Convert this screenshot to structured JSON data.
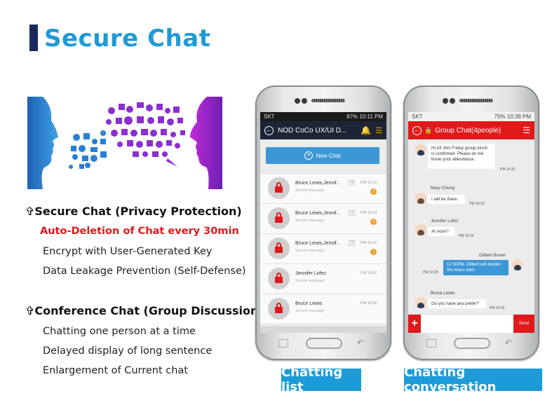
{
  "slide": {
    "title": "Secure Chat",
    "accent_color": "#1f9ad6",
    "bar_color": "#1b2a5c"
  },
  "features": {
    "secure": {
      "icon": "cross-bullet-icon",
      "heading": "✞Secure Chat (Privacy Protection)",
      "items": [
        "Auto-Deletion of Chat every 30min",
        "Encrypt with User-Generated Key",
        "Data Leakage Prevention (Self-Defense)"
      ]
    },
    "conference": {
      "icon": "cross-bullet-icon",
      "heading": "✞Conference Chat (Group Discussion)",
      "items": [
        "Chatting one person at a time",
        "Delayed display of long sentence",
        "Enlargement of Current chat"
      ]
    }
  },
  "list_phone": {
    "status": {
      "carrier": "SKT",
      "battery": "87%",
      "time": "10:11 PM"
    },
    "header_title": "NOD CoCo UX/UI D...",
    "new_chat_label": "New Chat",
    "rows": [
      {
        "name": "Bruce Lewis,Jennif...",
        "sub": "Secure message",
        "count": "4",
        "time": "PM 10:10",
        "badge": "2"
      },
      {
        "name": "Bruce Lewis,Jennif...",
        "sub": "Secure message",
        "count": "3",
        "time": "PM 10:10",
        "badge": "3"
      },
      {
        "name": "Bruce Lewis,Jennif...",
        "sub": "Secure message",
        "count": "3",
        "time": "PM 10:10",
        "badge": "2"
      },
      {
        "name": "Jennifer Lofez",
        "sub": "Secure message",
        "count": "",
        "time": "PM 10:07",
        "badge": ""
      },
      {
        "name": "Bruce Lewis",
        "sub": "Secure message",
        "count": "",
        "time": "PM 10:06",
        "badge": ""
      }
    ],
    "caption": "Chatting list"
  },
  "conv_phone": {
    "status": {
      "carrier": "SKT",
      "battery": "75%",
      "time": "10:39 PM"
    },
    "header_title": "Group Chat(4people)",
    "messages": [
      {
        "sender": "",
        "text": "Hi All, this Friday group lunch is confirmed. Please let me know your attendance.",
        "time": "PM 10:32"
      },
      {
        "sender": "Mary Chung",
        "text": "I will be there.",
        "time": "PM 10:33"
      },
      {
        "sender": "Jennifer Lofez",
        "text": "At noon?",
        "time": "PM 10:34"
      },
      {
        "sender": "Gilbert Brown",
        "text": "12:30PM. Gilbert will decide the menu later.",
        "time": "PM 10:35"
      },
      {
        "sender": "Bruce Lewis",
        "text": "Do you have any prefer?",
        "time": "PM 10:35"
      }
    ],
    "send_label": "Send",
    "add_label": "+",
    "caption": "Chatting conversation"
  },
  "colors": {
    "red": "#e0191b",
    "blue": "#3c97d6",
    "caption_bg": "#1d9bd8",
    "dark_header": "#1e2436"
  }
}
